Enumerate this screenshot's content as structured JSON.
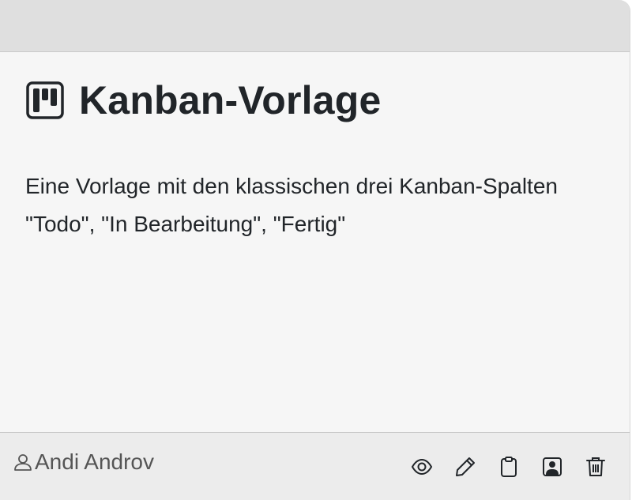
{
  "card": {
    "title": "Kanban-Vorlage",
    "title_icon": "kanban-icon",
    "description": "Eine Vorlage mit den klassischen drei Kanban-Spalten \"Todo\", \"In Bearbeitung\", \"Fertig\"",
    "author": "Andi Androv",
    "actions": [
      {
        "icon": "eye-icon"
      },
      {
        "icon": "pencil-icon"
      },
      {
        "icon": "clipboard-icon"
      },
      {
        "icon": "person-badge-icon"
      },
      {
        "icon": "trash-icon"
      }
    ]
  },
  "colors": {
    "text": "#212529",
    "muted": "#555555",
    "header_bg": "#dfdfdf",
    "body_bg": "#f6f6f6",
    "footer_bg": "#ececec"
  }
}
